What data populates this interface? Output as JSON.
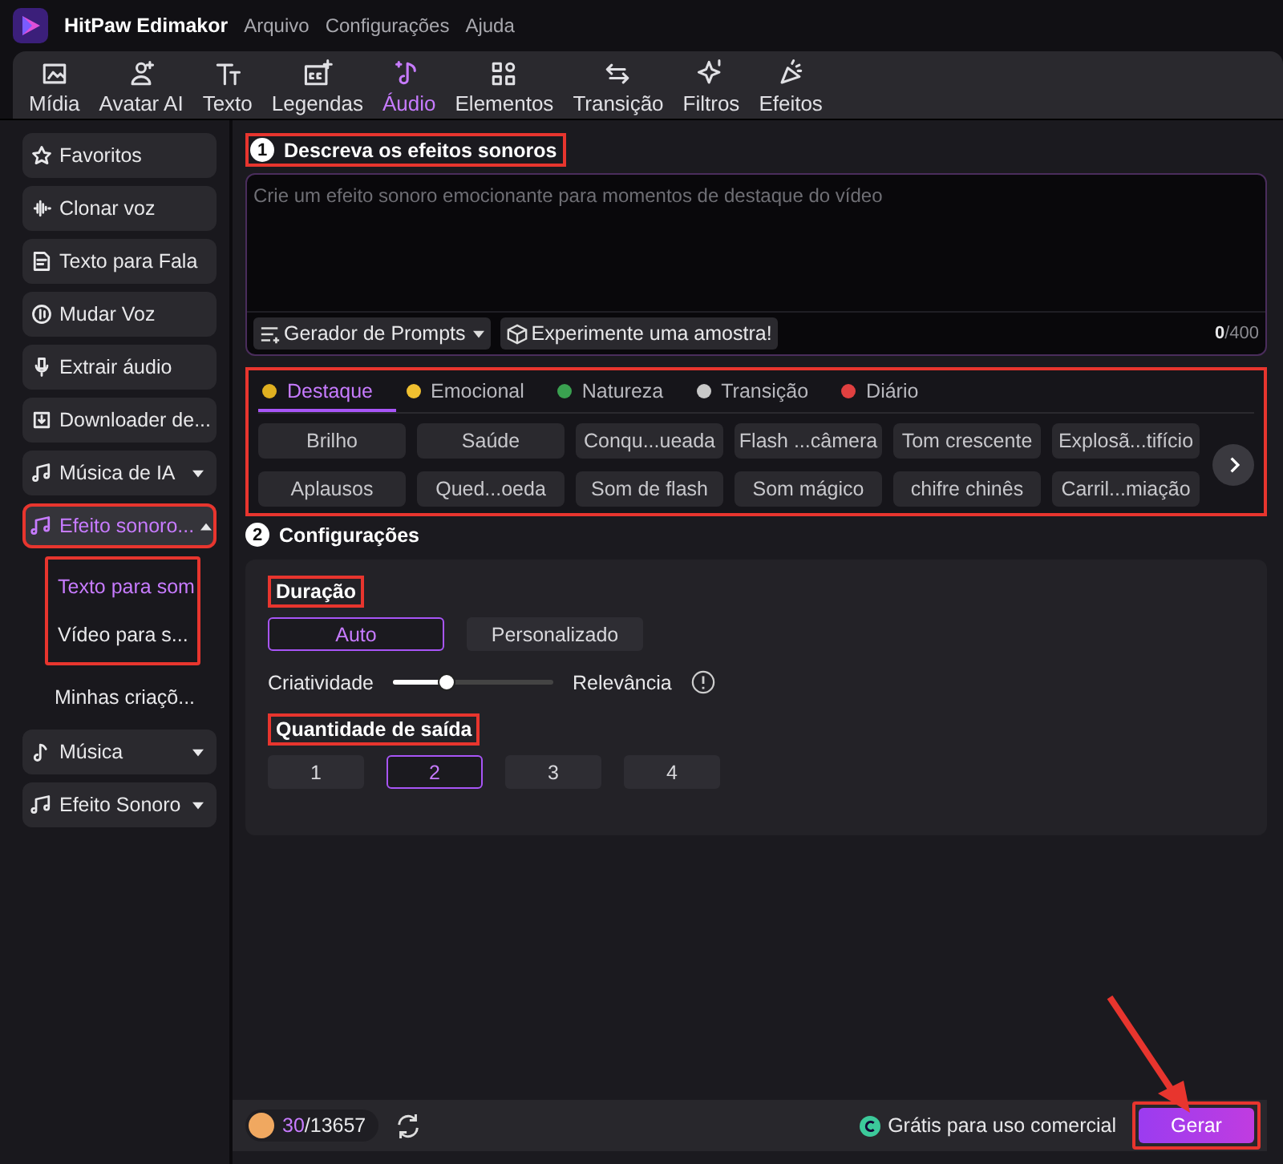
{
  "app": {
    "name": "HitPaw Edimakor",
    "menu": [
      "Arquivo",
      "Configurações",
      "Ajuda"
    ]
  },
  "toolbar": [
    {
      "label": "Mídia",
      "selected": false
    },
    {
      "label": "Avatar AI",
      "selected": false
    },
    {
      "label": "Texto",
      "selected": false
    },
    {
      "label": "Legendas",
      "selected": false
    },
    {
      "label": "Áudio",
      "selected": true
    },
    {
      "label": "Elementos",
      "selected": false
    },
    {
      "label": "Transição",
      "selected": false
    },
    {
      "label": "Filtros",
      "selected": false
    },
    {
      "label": "Efeitos",
      "selected": false
    }
  ],
  "sidebar": {
    "items": [
      {
        "kind": "item",
        "label": "Favoritos"
      },
      {
        "kind": "item",
        "label": "Clonar voz"
      },
      {
        "kind": "item",
        "label": "Texto para Fala"
      },
      {
        "kind": "item",
        "label": "Mudar Voz"
      },
      {
        "kind": "item",
        "label": "Extrair áudio"
      },
      {
        "kind": "item",
        "label": "Downloader de..."
      },
      {
        "kind": "group",
        "label": "Música de IA",
        "expanded": false,
        "selected": false,
        "highlighted": false
      },
      {
        "kind": "group",
        "label": "Efeito sonoro...",
        "expanded": true,
        "selected": true,
        "highlighted": true,
        "children": [
          {
            "label": "Texto para som",
            "selected": true,
            "highlighted": true
          },
          {
            "label": "Vídeo para s...",
            "selected": false,
            "highlighted": true
          },
          {
            "label": "Minhas criaçõ...",
            "selected": false,
            "highlighted": false
          }
        ]
      },
      {
        "kind": "group",
        "label": "Música",
        "expanded": false,
        "selected": false,
        "highlighted": false
      },
      {
        "kind": "group",
        "label": "Efeito Sonoro",
        "expanded": false,
        "selected": false,
        "highlighted": false
      }
    ]
  },
  "describe": {
    "step": "1",
    "title": "Descreva os efeitos sonoros",
    "highlighted": true,
    "placeholder": "Crie um efeito sonoro emocionante para momentos de destaque do vídeo",
    "prompt_button": "Gerador de Prompts",
    "sample_button": "Experimente uma amostra!",
    "count": "0",
    "max": "/400"
  },
  "categories": {
    "highlighted": true,
    "tabs": [
      {
        "label": "Destaque",
        "selected": true
      },
      {
        "label": "Emocional",
        "selected": false
      },
      {
        "label": "Natureza",
        "selected": false
      },
      {
        "label": "Transição",
        "selected": false
      },
      {
        "label": "Diário",
        "selected": false
      }
    ],
    "chips": [
      "Brilho",
      "Saúde",
      "Conqu...ueada",
      "Flash ...câmera",
      "Tom crescente",
      "Explosã...tifício",
      "Aplausos",
      "Qued...oeda",
      "Som de flash",
      "Som mágico",
      "chifre chinês",
      "Carril...miação"
    ]
  },
  "settings": {
    "step": "2",
    "title": "Configurações",
    "duration": {
      "label": "Duração",
      "highlighted": true,
      "options": [
        {
          "label": "Auto",
          "selected": true
        },
        {
          "label": "Personalizado",
          "selected": false
        }
      ]
    },
    "slider": {
      "left": "Criatividade",
      "right": "Relevância",
      "level": 0.33
    },
    "quantity": {
      "label": "Quantidade de saída",
      "highlighted": true,
      "options": [
        {
          "label": "1",
          "selected": false
        },
        {
          "label": "2",
          "selected": true
        },
        {
          "label": "3",
          "selected": false
        },
        {
          "label": "4",
          "selected": false
        }
      ]
    }
  },
  "footer": {
    "used": "30",
    "total": "/13657",
    "license": "Grátis para uso comercial",
    "generate": "Gerar",
    "generate_highlighted": true
  }
}
